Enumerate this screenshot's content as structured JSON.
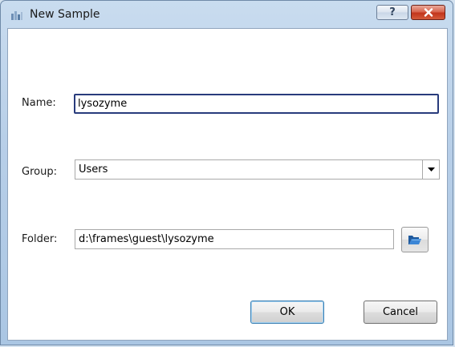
{
  "window": {
    "title": "New Sample",
    "help_label": "?",
    "close_label": "close"
  },
  "form": {
    "name_label": "Name:",
    "name_value": "lysozyme",
    "group_label": "Group:",
    "group_value": "Users",
    "folder_label": "Folder:",
    "folder_value": "d:\\frames\\guest\\lysozyme"
  },
  "buttons": {
    "ok_label": "OK",
    "cancel_label": "Cancel"
  },
  "icons": {
    "app": "app-icon",
    "help": "help-icon",
    "close": "close-icon",
    "dropdown": "dropdown-arrow-icon",
    "browse": "folder-browse-icon"
  },
  "colors": {
    "titlebar": "#b8cfe8",
    "close_button": "#c2351b",
    "focus_border": "#283b7c",
    "browse_icon": "#2b6cb8"
  }
}
